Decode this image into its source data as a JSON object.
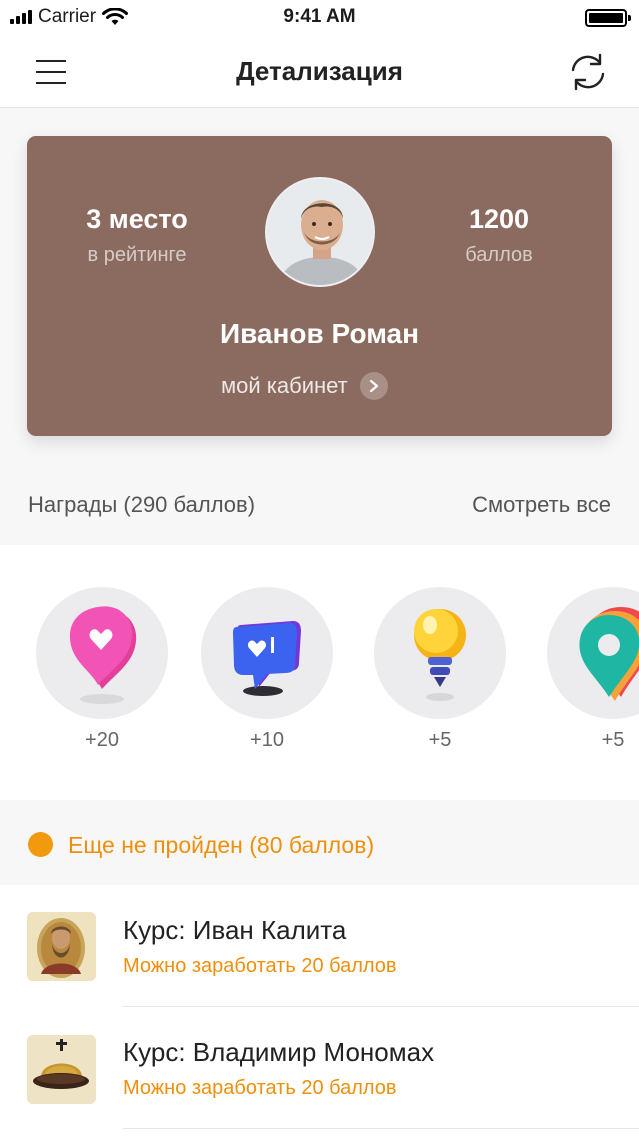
{
  "status_bar": {
    "carrier": "Carrier",
    "time": "9:41 AM"
  },
  "nav": {
    "title": "Детализация",
    "menu_icon": "menu-icon",
    "refresh_icon": "refresh-icon"
  },
  "profile": {
    "rank_value": "3 место",
    "rank_label": "в рейтинге",
    "points_value": "1200",
    "points_label": "баллов",
    "name": "Иванов Роман",
    "cabinet_label": "мой кабинет",
    "card_color": "#8b6b5f"
  },
  "awards": {
    "title": "Награды (290 баллов)",
    "see_all": "Смотреть все",
    "items": [
      {
        "icon": "heart-bubble-icon",
        "points": "+20"
      },
      {
        "icon": "notification-bubble-icon",
        "points": "+10"
      },
      {
        "icon": "light-bulb-icon",
        "points": "+5"
      },
      {
        "icon": "location-pin-icon",
        "points": "+5"
      }
    ]
  },
  "status": {
    "text": "Еще не пройден (80 баллов)",
    "color": "#f29a0f"
  },
  "courses": [
    {
      "title": "Курс: Иван Калита",
      "subtitle": "Можно заработать 20 баллов",
      "icon": "icon-portrait-thumbnail"
    },
    {
      "title": "Курс: Владимир Мономах",
      "subtitle": "Можно заработать 20 баллов",
      "icon": "crown-cap-thumbnail"
    }
  ]
}
